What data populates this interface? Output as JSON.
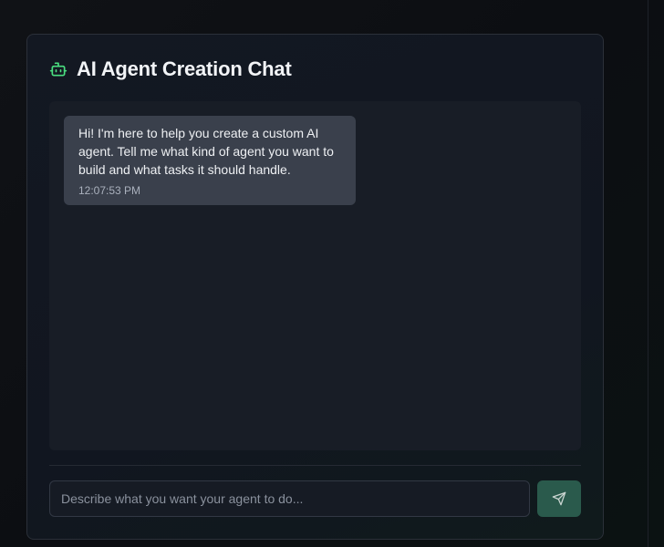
{
  "chat": {
    "title": "AI Agent Creation Chat",
    "header_icon": "bot-icon",
    "accent_color": "#4ade80",
    "messages": [
      {
        "sender": "assistant",
        "text": "Hi! I'm here to help you create a custom AI agent. Tell me what kind of agent you want to build and what tasks it should handle.",
        "time": "12:07:53 PM"
      }
    ]
  },
  "composer": {
    "value": "",
    "placeholder": "Describe what you want your agent to do...",
    "send_icon": "send-icon",
    "send_color": "#2a5a4c"
  }
}
